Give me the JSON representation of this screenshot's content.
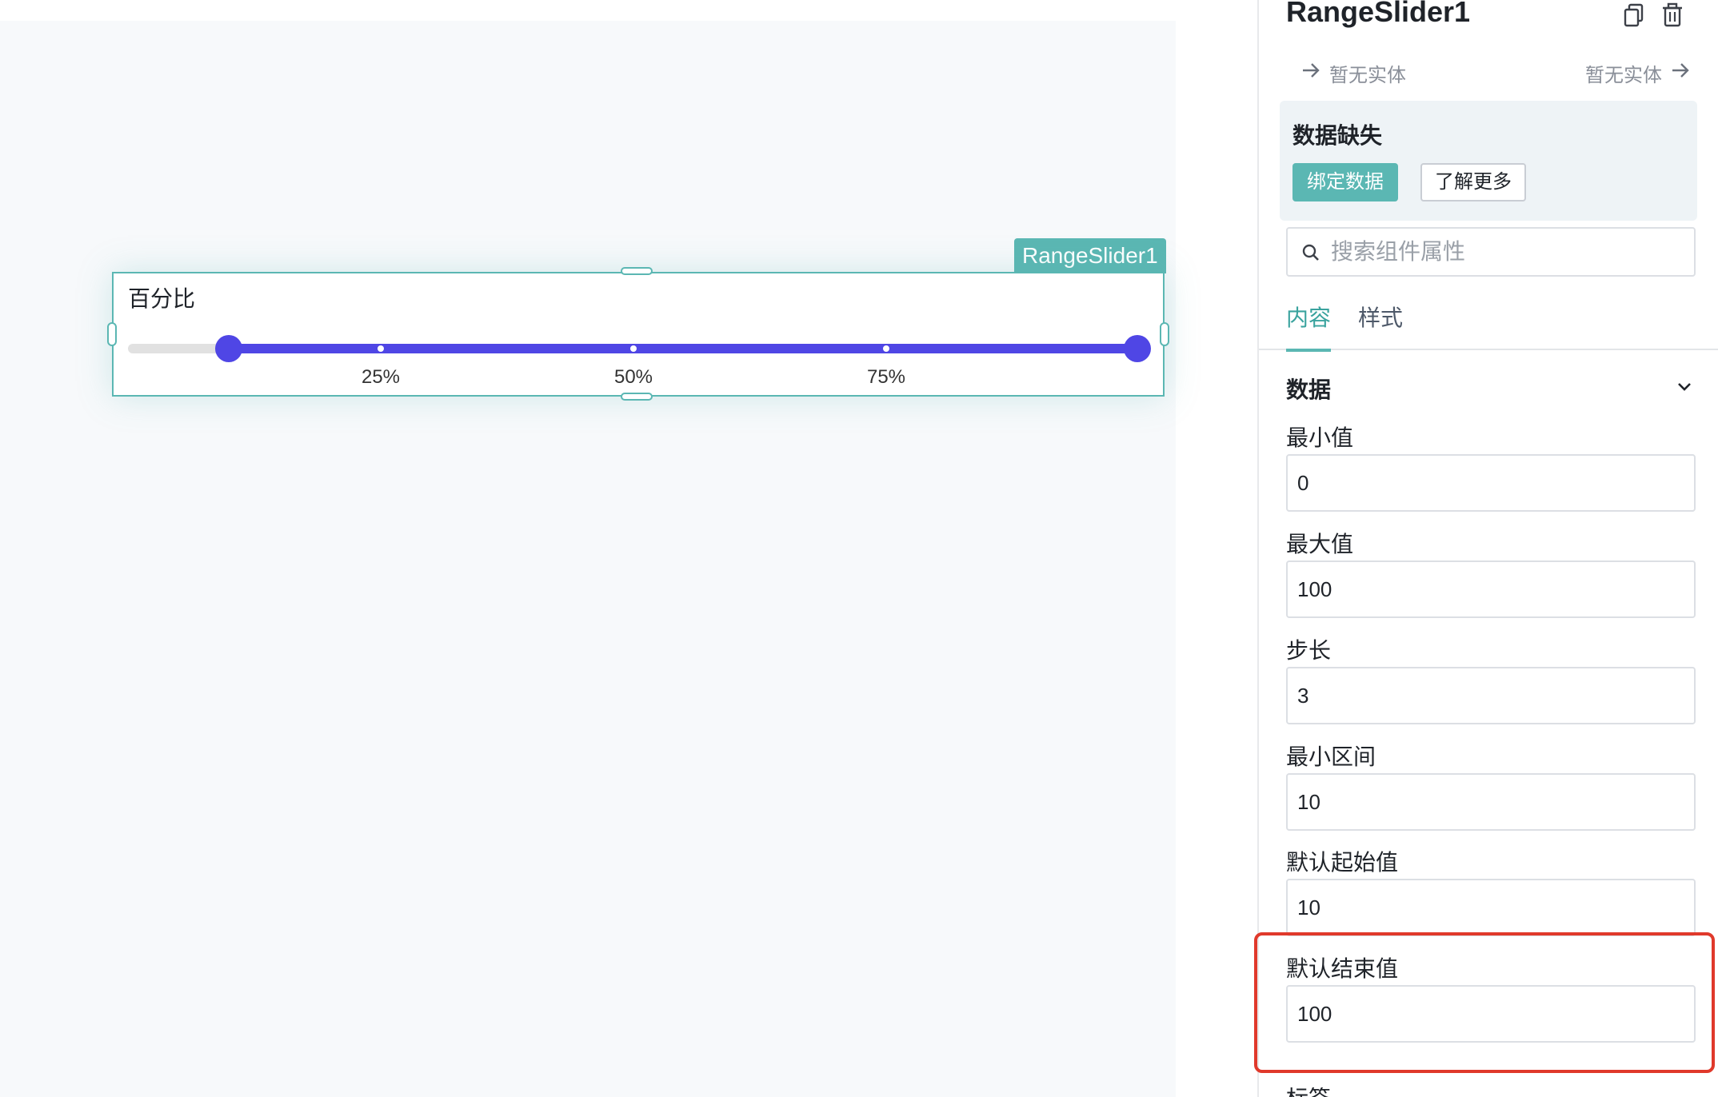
{
  "canvas": {
    "widget": {
      "tag": "RangeSlider1",
      "label": "百分比",
      "min": 0,
      "max": 100,
      "start_value": 10,
      "end_value": 100,
      "marks": [
        {
          "value": 25,
          "label": "25%"
        },
        {
          "value": 50,
          "label": "50%"
        },
        {
          "value": 75,
          "label": "75%"
        }
      ],
      "track_color": "#e1e1e1",
      "fill_color": "#4f46e5",
      "border_color": "#5bb7b3"
    }
  },
  "panel": {
    "title": "RangeSlider1",
    "copy_icon": "copy-icon",
    "delete_icon": "trash-icon",
    "entity_left": "暂无实体",
    "entity_right": "暂无实体",
    "missing": {
      "title": "数据缺失",
      "bind_label": "绑定数据",
      "learn_label": "了解更多"
    },
    "search": {
      "placeholder": "搜索组件属性",
      "value": ""
    },
    "tabs": [
      {
        "label": "内容",
        "active": true
      },
      {
        "label": "样式",
        "active": false
      }
    ],
    "section": {
      "title": "数据",
      "icon": "chevron-down-icon"
    },
    "fields": [
      {
        "label": "最小值",
        "value": "0"
      },
      {
        "label": "最大值",
        "value": "100"
      },
      {
        "label": "步长",
        "value": "3"
      },
      {
        "label": "最小区间",
        "value": "10"
      },
      {
        "label": "默认起始值",
        "value": "10"
      },
      {
        "label": "默认结束值",
        "value": "100"
      }
    ],
    "next_label": "标签"
  },
  "colors": {
    "accent": "#5bb7b3",
    "slider": "#4f46e5",
    "highlight": "#e0392b"
  }
}
